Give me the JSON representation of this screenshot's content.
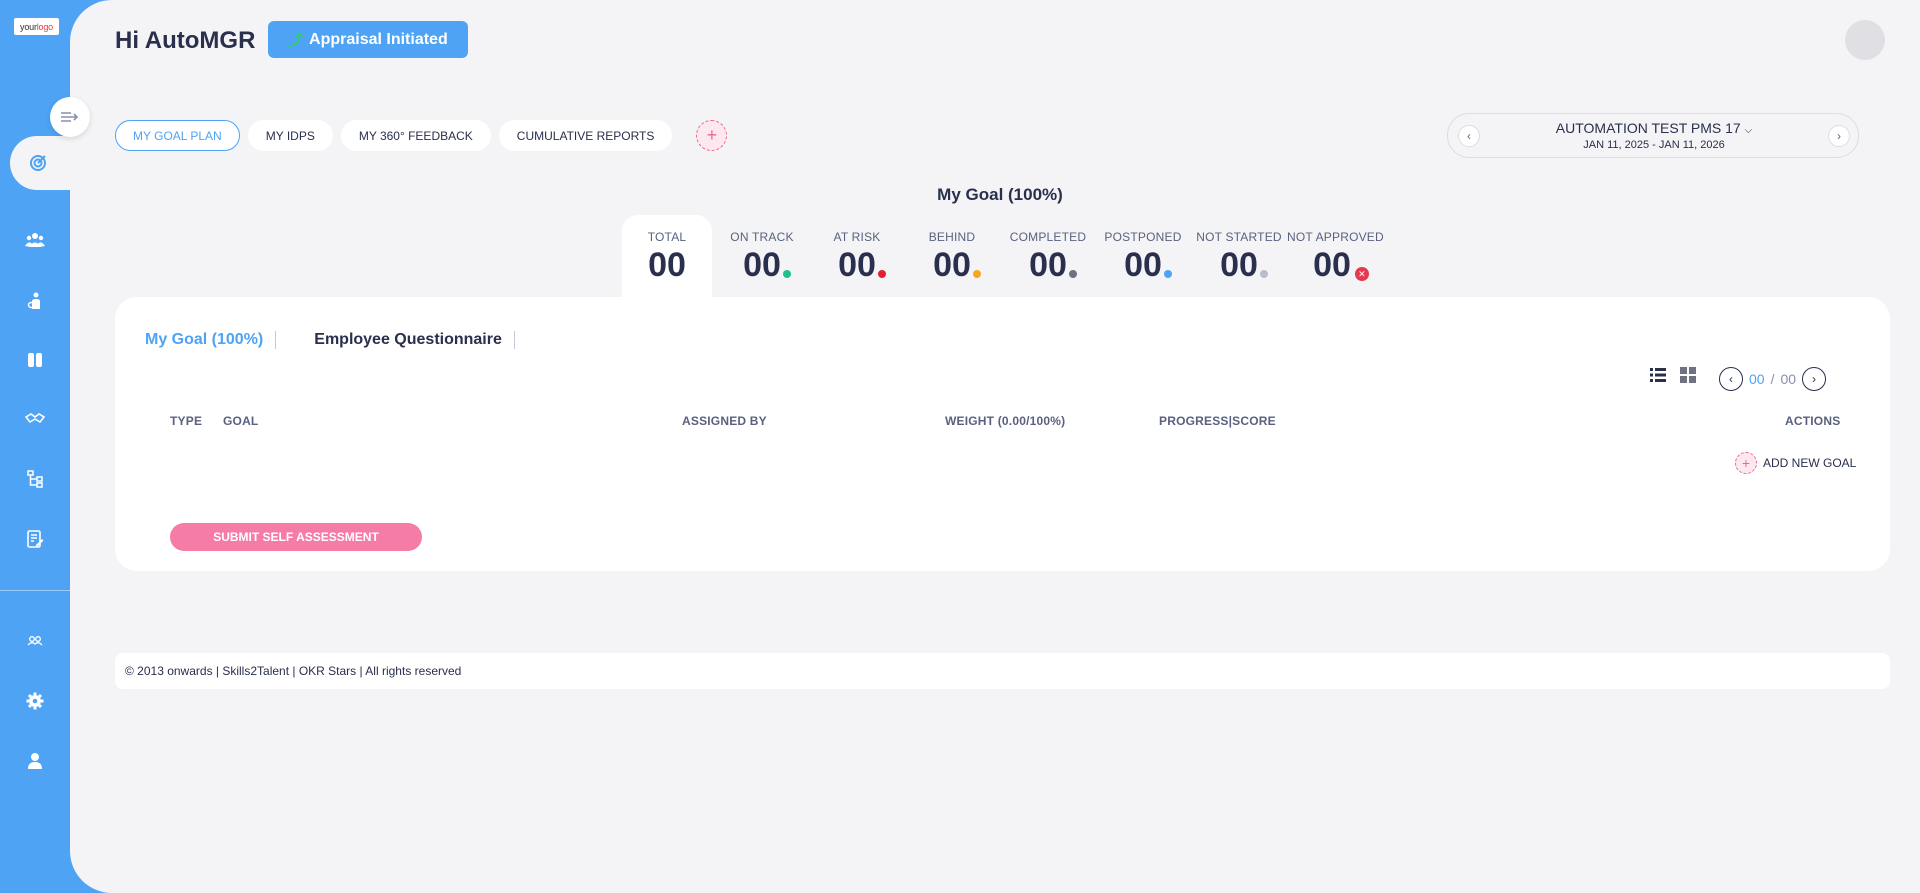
{
  "sidebar": {
    "logo_pre": "your",
    "logo_accent": "logo",
    "icons": [
      "goals-target-icon",
      "team-icon",
      "person-icon",
      "book-icon",
      "handshake-icon",
      "org-chart-icon",
      "document-edit-icon",
      "people-group-icon",
      "settings-gear-icon",
      "user-profile-icon"
    ]
  },
  "header": {
    "greeting": "Hi AutoMGR",
    "status_label": "Appraisal Initiated"
  },
  "tabs": [
    {
      "label": "MY GOAL PLAN",
      "active": true
    },
    {
      "label": "MY IDPS",
      "active": false
    },
    {
      "label": "MY 360° FEEDBACK",
      "active": false
    },
    {
      "label": "CUMULATIVE REPORTS",
      "active": false
    }
  ],
  "cycle": {
    "title": "AUTOMATION TEST PMS 17",
    "dates": "JAN 11, 2025 - JAN 11, 2026"
  },
  "goal_heading": "My Goal (100%)",
  "stats": [
    {
      "label": "TOTAL",
      "value": "00",
      "color": ""
    },
    {
      "label": "ON TRACK",
      "value": "00",
      "color": "#1fbf8f"
    },
    {
      "label": "AT RISK",
      "value": "00",
      "color": "#e5202e"
    },
    {
      "label": "BEHIND",
      "value": "00",
      "color": "#f5a623"
    },
    {
      "label": "COMPLETED",
      "value": "00",
      "color": "#6e7180"
    },
    {
      "label": "POSTPONED",
      "value": "00",
      "color": "#4ea3f5"
    },
    {
      "label": "NOT STARTED",
      "value": "00",
      "color": "#b9bccb"
    },
    {
      "label": "NOT APPROVED",
      "value": "00",
      "color": "#e53950"
    }
  ],
  "card": {
    "tabs": [
      {
        "label": "My Goal (100%)",
        "active": true
      },
      {
        "label": "Employee Questionnaire",
        "active": false
      }
    ],
    "pager_current": "00",
    "pager_sep": "/",
    "pager_total": "00",
    "columns": {
      "type": "TYPE",
      "goal": "GOAL",
      "assigned_by": "ASSIGNED BY",
      "weight": "WEIGHT (0.00/100%)",
      "progress": "PROGRESS|SCORE",
      "actions": "ACTIONS"
    },
    "add_goal_label": "ADD NEW GOAL",
    "submit_label": "SUBMIT SELF ASSESSMENT"
  },
  "footer": "© 2013 onwards | Skills2Talent | OKR Stars | All rights reserved",
  "colors": {
    "accent": "#4ea3f5",
    "pink": "#f57ca7",
    "text": "#292f4c"
  }
}
